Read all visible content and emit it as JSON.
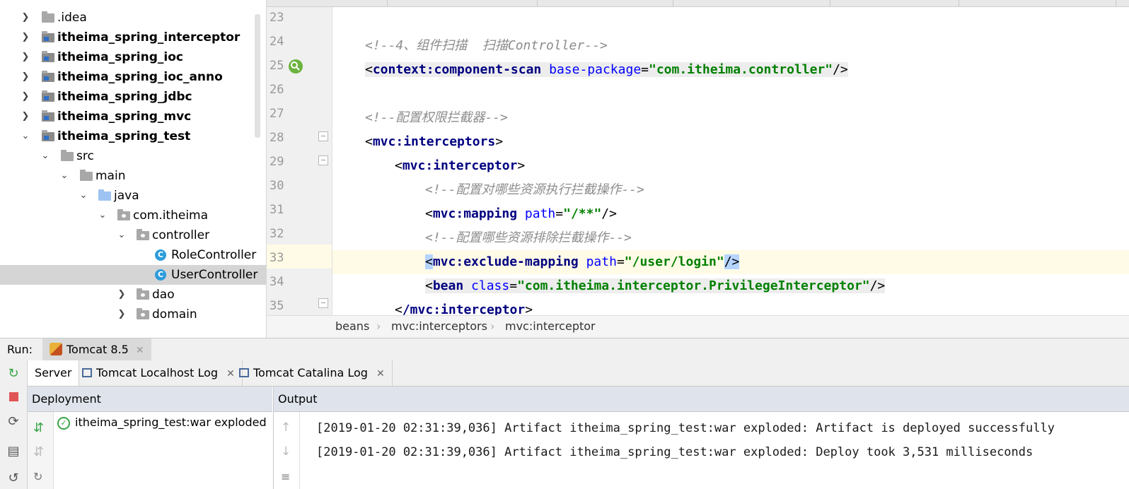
{
  "project_tree": {
    "items": [
      {
        "label": ".idea",
        "bold": false
      },
      {
        "label": "itheima_spring_interceptor",
        "bold": true
      },
      {
        "label": "itheima_spring_ioc",
        "bold": true
      },
      {
        "label": "itheima_spring_ioc_anno",
        "bold": true
      },
      {
        "label": "itheima_spring_jdbc",
        "bold": true
      },
      {
        "label": "itheima_spring_mvc",
        "bold": true
      },
      {
        "label": "itheima_spring_test",
        "bold": true
      },
      {
        "label": "src",
        "bold": false
      },
      {
        "label": "main",
        "bold": false
      },
      {
        "label": "java",
        "bold": false
      },
      {
        "label": "com.itheima",
        "bold": false
      },
      {
        "label": "controller",
        "bold": false
      },
      {
        "label": "RoleController",
        "bold": false
      },
      {
        "label": "UserController",
        "bold": false
      },
      {
        "label": "dao",
        "bold": false
      },
      {
        "label": "domain",
        "bold": false
      }
    ]
  },
  "editor": {
    "line_numbers": [
      "23",
      "24",
      "25",
      "26",
      "27",
      "28",
      "29",
      "30",
      "31",
      "32",
      "33",
      "34",
      "35"
    ],
    "code": {
      "l24_comment": "<!--4、组件扫描  扫描Controller-->",
      "l25_tag": "context:component-scan",
      "l25_attr": "base-package",
      "l25_value": "\"com.itheima.controller\"",
      "l27_comment": "<!--配置权限拦截器-->",
      "l28_tag": "mvc:interceptors",
      "l29_tag": "mvc:interceptor",
      "l30_comment": "<!--配置对哪些资源执行拦截操作-->",
      "l31_tag": "mvc:mapping",
      "l31_attr": "path",
      "l31_value": "\"/**\"",
      "l32_comment": "<!--配置哪些资源排除拦截操作-->",
      "l33_tag": "mvc:exclude-mapping",
      "l33_attr": "path",
      "l33_value": "\"/user/login\"",
      "l34_tag": "bean",
      "l34_attr": "class",
      "l34_value": "\"com.itheima.interceptor.PrivilegeInterceptor\"",
      "l35_tag": "/mvc:interceptor"
    }
  },
  "breadcrumb": [
    "beans",
    "mvc:interceptors",
    "mvc:interceptor"
  ],
  "run": {
    "label": "Run:",
    "config_tab": "Tomcat 8.5",
    "subtabs": [
      "Server",
      "Tomcat Localhost Log",
      "Tomcat Catalina Log"
    ],
    "deployment_header": "Deployment",
    "output_header": "Output",
    "deployment_item": "itheima_spring_test:war exploded",
    "output_lines": [
      "[2019-01-20 02:31:39,036] Artifact itheima_spring_test:war exploded: Artifact is deployed successfully",
      "[2019-01-20 02:31:39,036] Artifact itheima_spring_test:war exploded: Deploy took 3,531 milliseconds"
    ]
  },
  "colors": {
    "tag": "#000080",
    "attribute": "#0000ff",
    "value": "#008000",
    "comment": "#8c8c8c",
    "selection": "#d5d5d5",
    "caret_line": "#fffbe6"
  }
}
